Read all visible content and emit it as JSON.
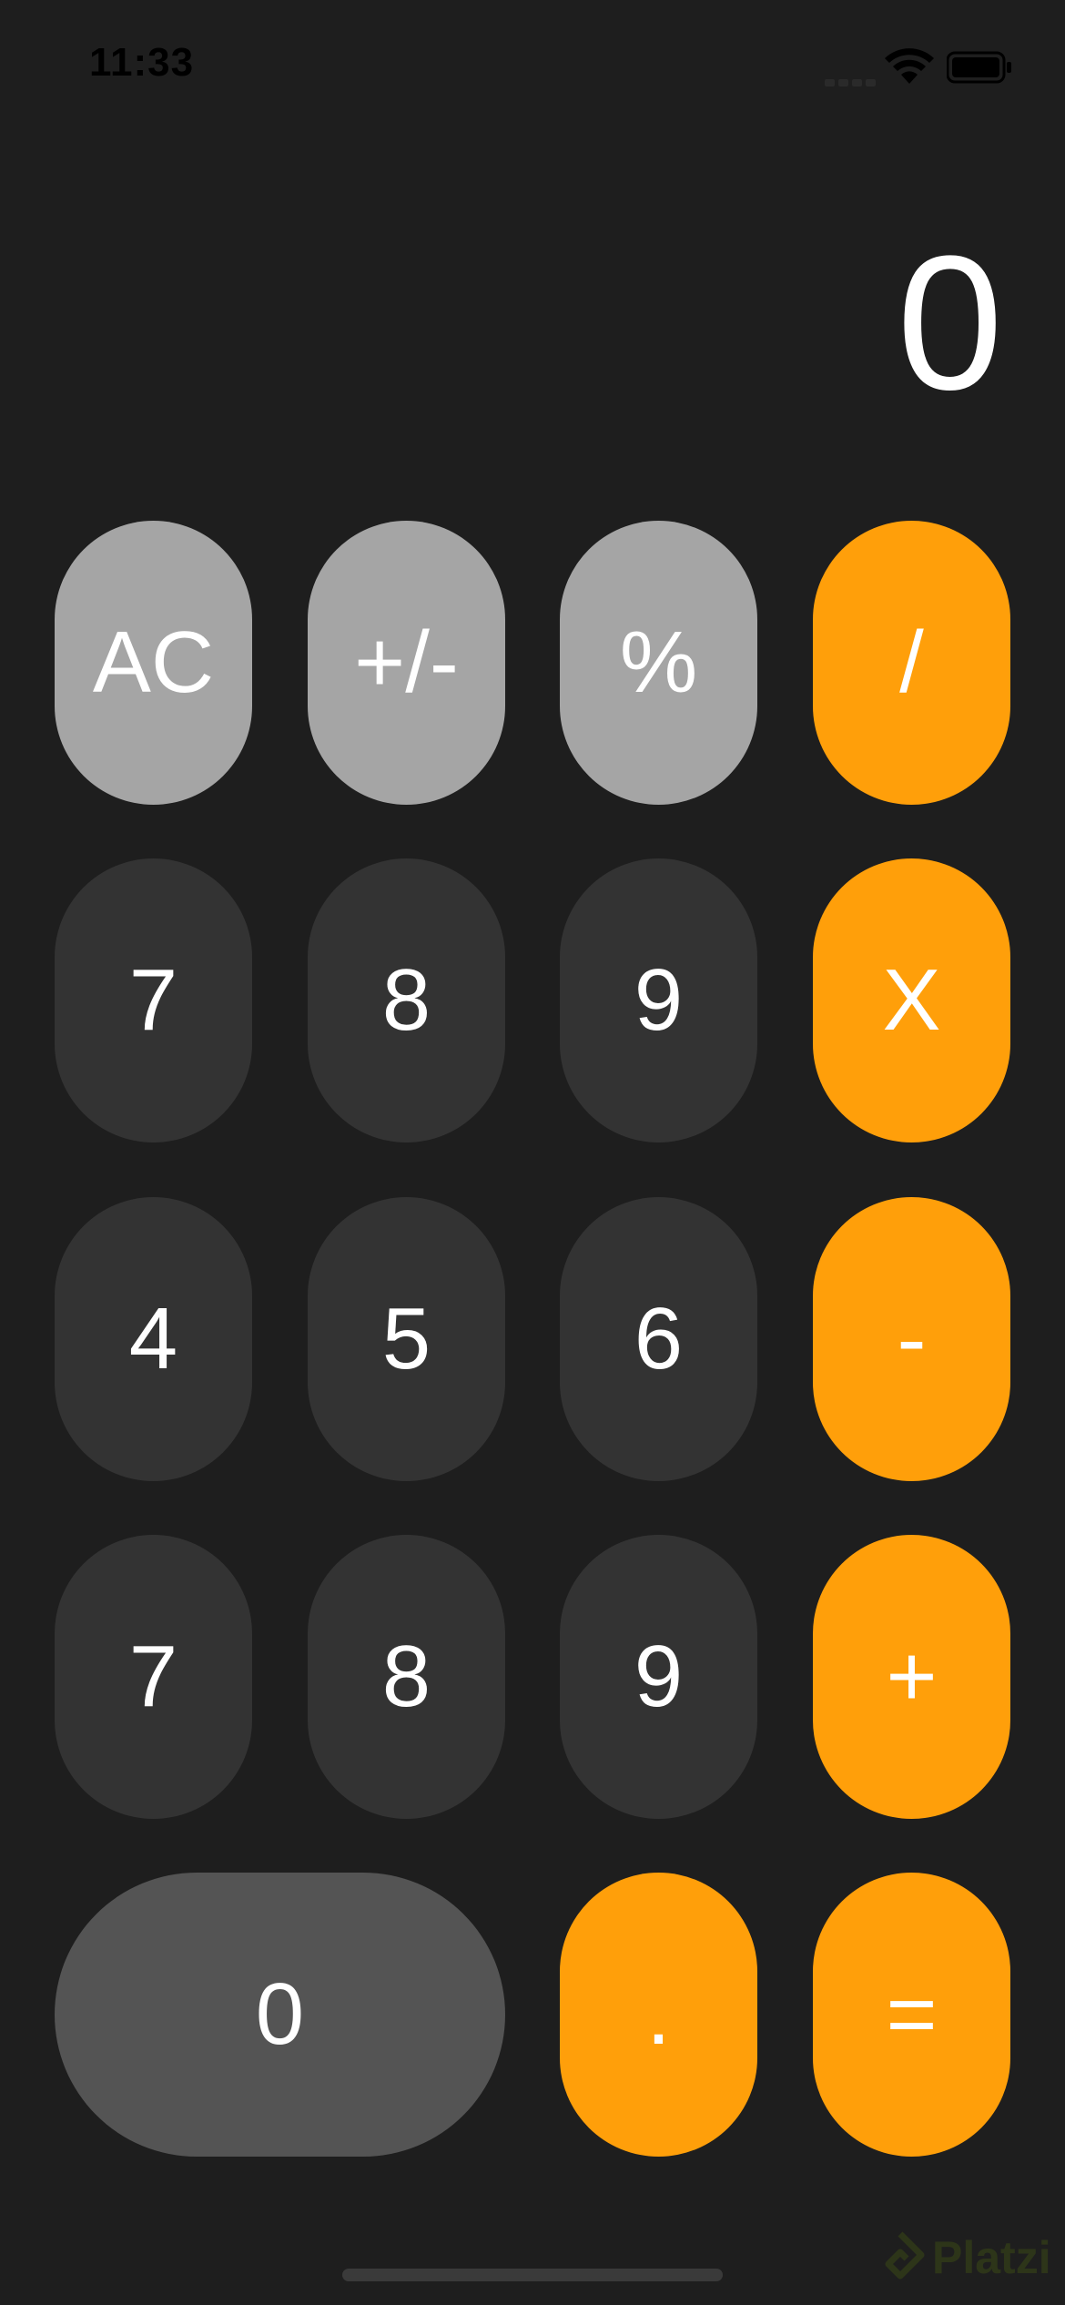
{
  "status_bar": {
    "time": "11:33"
  },
  "display": {
    "value": "0"
  },
  "keypad": {
    "row1": [
      "AC",
      "+/-",
      "%",
      "/"
    ],
    "row2": [
      "7",
      "8",
      "9",
      "X"
    ],
    "row3": [
      "4",
      "5",
      "6",
      "-"
    ],
    "row4": [
      "7",
      "8",
      "9",
      "+"
    ],
    "row5": [
      "0",
      ".",
      "="
    ]
  },
  "watermark": {
    "text": "Platzi"
  },
  "colors": {
    "background": "#1e1e1e",
    "function_key": "#a5a5a5",
    "digit_key": "#333333",
    "operator_key": "#ff9f0a",
    "zero_key": "#545454"
  }
}
